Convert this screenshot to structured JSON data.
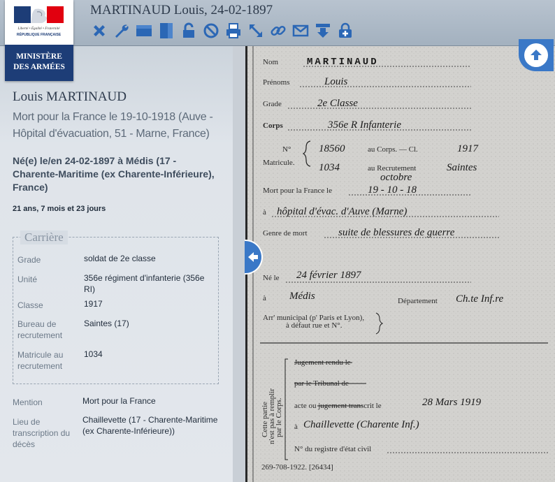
{
  "header": {
    "title": "MARTINAUD Louis, 24-02-1897",
    "logo_top_text": "Liberté • Égalité • Fraternité",
    "logo_republic": "RÉPUBLIQUE FRANÇAISE",
    "logo_line1": "MINISTÈRE",
    "logo_line2": "DES ARMÉES",
    "tools": [
      "close-icon",
      "wrench-icon",
      "panel-horizontal-icon",
      "panel-vertical-icon",
      "lock-icon",
      "block-icon",
      "print-icon",
      "resize-icon",
      "link-icon",
      "mail-icon",
      "download-icon",
      "lock-add-icon"
    ]
  },
  "person": {
    "name": "Louis MARTINAUD",
    "death": "Mort pour la France le 19-10-1918 (Auve - Hôpital d'évacuation, 51 - Marne, France)",
    "birth": "Né(e) le/en 24-02-1897 à Médis (17 - Charente-Maritime (ex Charente-Inférieure), France)",
    "age": "21 ans, 7 mois et 23 jours"
  },
  "career": {
    "legend": "Carrière",
    "rows": [
      {
        "label": "Grade",
        "value": "soldat de 2e classe"
      },
      {
        "label": "Unité",
        "value": "356e régiment d'infanterie (356e RI)"
      },
      {
        "label": "Classe",
        "value": "1917"
      },
      {
        "label": "Bureau de recrutement",
        "value": "Saintes (17)"
      },
      {
        "label": "Matricule au recrutement",
        "value": "1034"
      }
    ]
  },
  "extra": {
    "mention_label": "Mention",
    "mention_value": "Mort pour la France",
    "lieu_label": "Lieu de transcription du décès",
    "lieu_value": "Chaillevette (17 - Charente-Maritime (ex Charente-Inférieure))"
  },
  "document": {
    "nom_label": "Nom",
    "nom_value": "MARTINAUD",
    "prenoms_label": "Prénoms",
    "prenoms_value": "Louis",
    "grade_label": "Grade",
    "grade_value": "2e Classe",
    "corps_label": "Corps",
    "corps_value": "356e R Infanterie",
    "no_label": "N°",
    "matricule_label": "Matricule.",
    "no_value": "18560",
    "corps_suffix": "au Corps. — Cl.",
    "classe_value": "1917",
    "matricule_value": "1034",
    "recrutement_label": "au Recrutement",
    "recrutement_value": "Saintes",
    "mort_label": "Mort pour la France le",
    "mort_value": "19 - 10 - 18",
    "mort_month_note": "octobre",
    "a_label": "à",
    "lieu_value": "hôpital d'évac. d'Auve (Marne)",
    "genre_label": "Genre de mort",
    "genre_value": "suite de blessures de guerre",
    "ne_label": "Né le",
    "ne_value": "24 février 1897",
    "a2_label": "à",
    "ne_lieu_value": "Médis",
    "departement_label": "Département",
    "departement_value": "Ch.te Inf.re",
    "arr_label": "Arr' municipal (p' Paris et Lyon),",
    "arr_label2": "à défaut rue et N°.",
    "side_note1": "Cette partie",
    "side_note2": "n'est pas à remplir",
    "side_note3": "par le Corps.",
    "jugement_label": "Jugement rendu le",
    "tribunal_label": "par le Tribunal de",
    "acte_label": "acte ou jugement transcrit le",
    "acte_value": "28 Mars 1919",
    "a3_label": "à",
    "acte_lieu_value": "Chaillevette (Charente Inf.)",
    "registre_label": "N° du registre d'état civil",
    "footer": "269-708-1922. [26434]"
  }
}
